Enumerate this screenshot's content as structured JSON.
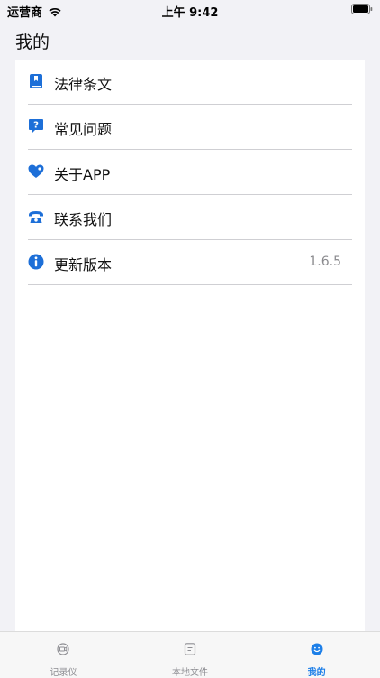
{
  "status_bar": {
    "carrier": "运营商",
    "time": "上午 9:42"
  },
  "page": {
    "title": "我的"
  },
  "menu": {
    "items": [
      {
        "label": "法律条文",
        "icon": "book-icon",
        "value": ""
      },
      {
        "label": "常见问题",
        "icon": "question-bubble-icon",
        "value": ""
      },
      {
        "label": "关于APP",
        "icon": "heart-icon",
        "value": ""
      },
      {
        "label": "联系我们",
        "icon": "telephone-icon",
        "value": ""
      },
      {
        "label": "更新版本",
        "icon": "info-icon",
        "value": "1.6.5"
      }
    ]
  },
  "tab_bar": {
    "tabs": [
      {
        "label": "记录仪",
        "icon": "recorder-icon",
        "active": false
      },
      {
        "label": "本地文件",
        "icon": "document-icon",
        "active": false
      },
      {
        "label": "我的",
        "icon": "smiley-icon",
        "active": true
      }
    ]
  },
  "colors": {
    "accent": "#1d7fe8",
    "background": "#f2f2f6",
    "card": "#ffffff",
    "secondary_text": "#8a8a8e"
  }
}
